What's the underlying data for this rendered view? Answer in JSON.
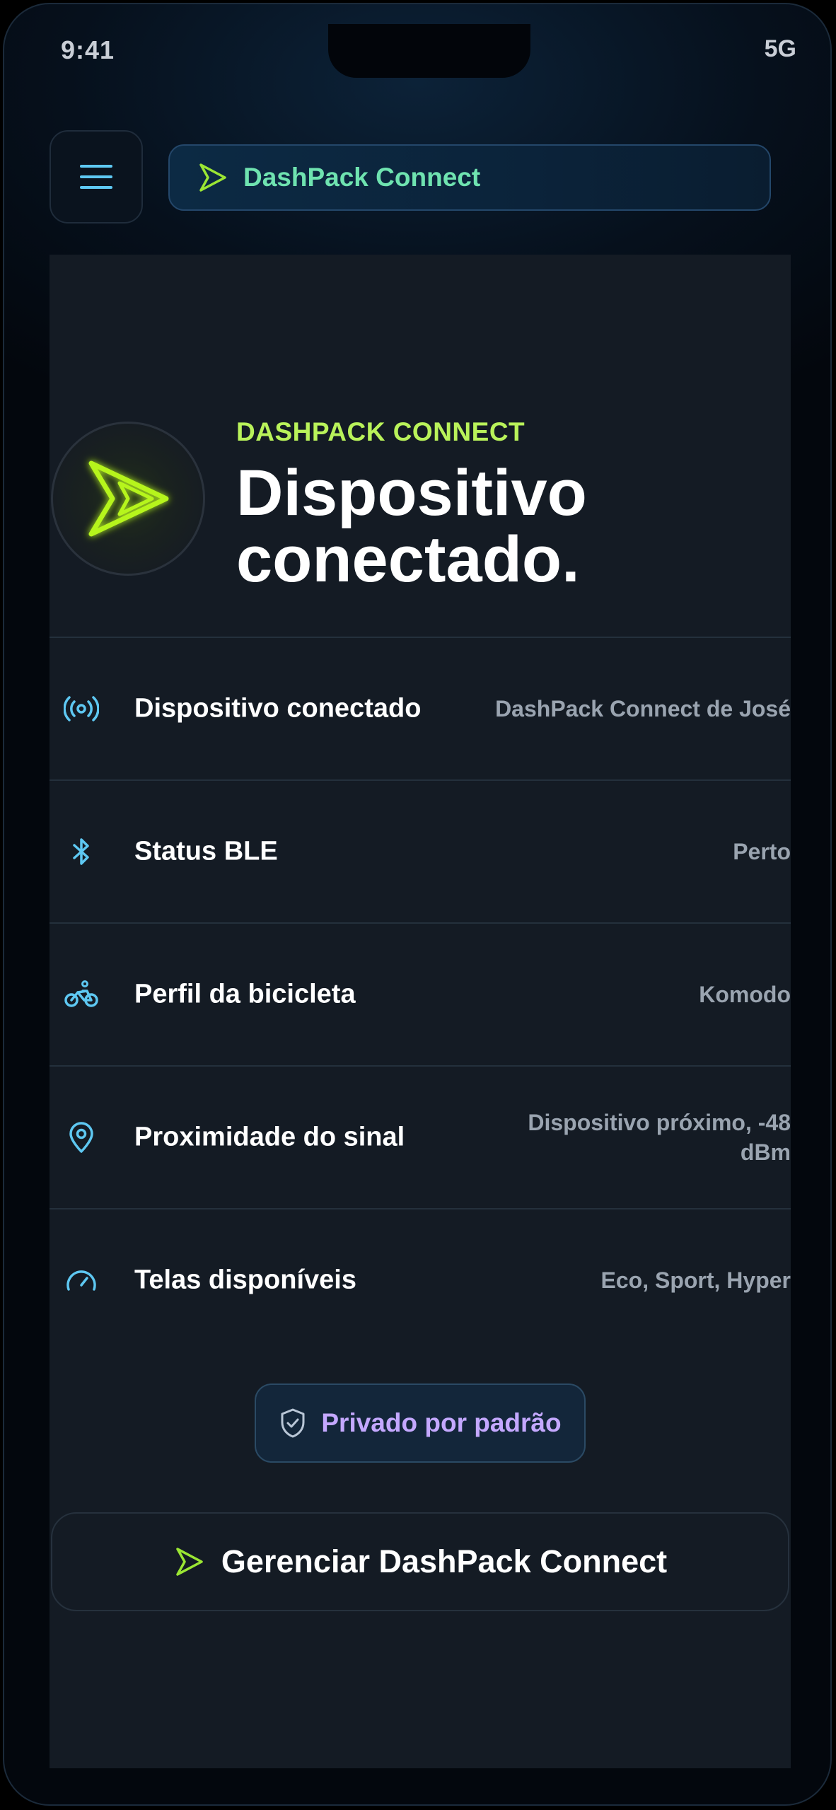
{
  "status_bar": {
    "time": "9:41",
    "network": "5G"
  },
  "header": {
    "menu_icon": "hamburger-icon",
    "app_name": "DashPack Connect",
    "logo_icon": "chevron-logo-icon"
  },
  "hero": {
    "eyebrow": "DASHPACK CONNECT",
    "title_line1": "Dispositivo",
    "title_line2": "conectado."
  },
  "rows": [
    {
      "icon": "broadcast-icon",
      "label": "Dispositivo conectado",
      "value": "DashPack Connect de José"
    },
    {
      "icon": "bluetooth-icon",
      "label": "Status BLE",
      "value": "Perto"
    },
    {
      "icon": "bicycle-icon",
      "label": "Perfil da bicicleta",
      "value": "Komodo"
    },
    {
      "icon": "location-pin-icon",
      "label": "Proximidade do sinal",
      "value": "Dispositivo próximo, -48 dBm"
    },
    {
      "icon": "speedometer-icon",
      "label": "Telas disponíveis",
      "value": "Eco, Sport, Hyper"
    }
  ],
  "privacy_badge": {
    "icon": "shield-check-icon",
    "label": "Privado por padrão"
  },
  "manage_button": {
    "icon": "chevron-logo-icon",
    "label": "Gerenciar DashPack Connect"
  },
  "colors": {
    "accent_green": "#b9f25a",
    "app_name_teal": "#6fe3b0",
    "icon_blue": "#5ec8f2",
    "badge_purple": "#c4a8ff",
    "card_bg": "#141b24"
  }
}
